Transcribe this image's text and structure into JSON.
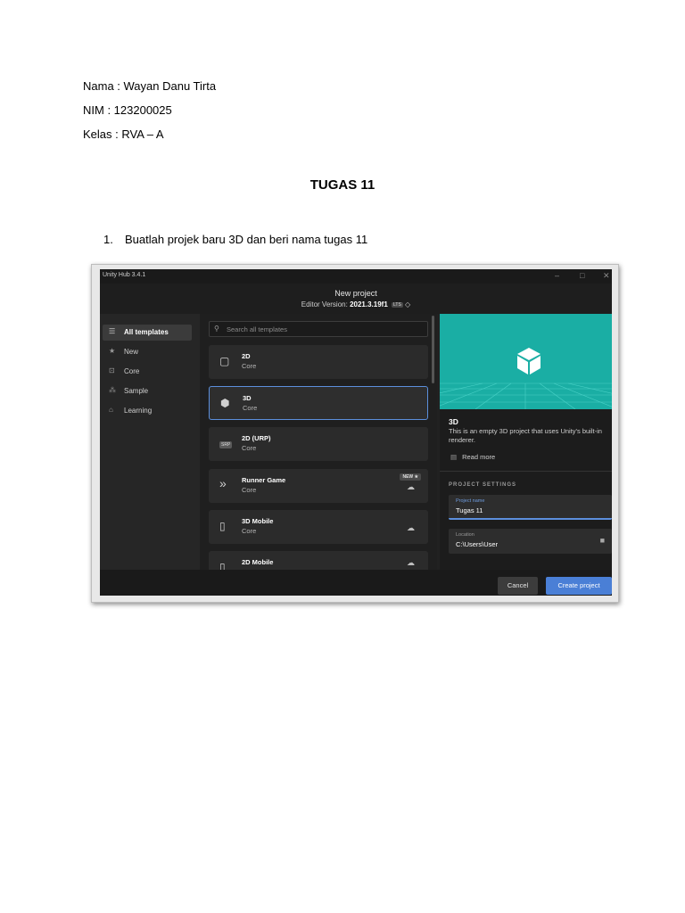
{
  "student": {
    "nama": "Nama : Wayan Danu Tirta",
    "nim": "NIM : 123200025",
    "kelas": "Kelas : RVA – A"
  },
  "doc_title": "TUGAS 11",
  "instruction": {
    "number": "1.",
    "text": "Buatlah projek baru 3D dan beri nama tugas 11"
  },
  "hub": {
    "app_title": "Unity Hub 3.4.1",
    "window_controls": [
      "–",
      "□",
      "✕"
    ],
    "header": {
      "title": "New project",
      "editor_label": "Editor Version:",
      "editor_version": "2021.3.19f1",
      "lts": "LTS",
      "chevron": "◇"
    },
    "sidebar": [
      {
        "label": "All templates",
        "icon": "list-icon",
        "glyph": "☰",
        "active": true
      },
      {
        "label": "New",
        "icon": "star-icon",
        "glyph": "★",
        "active": false
      },
      {
        "label": "Core",
        "icon": "core-icon",
        "glyph": "⊡",
        "active": false
      },
      {
        "label": "Sample",
        "icon": "sample-icon",
        "glyph": "⁂",
        "active": false
      },
      {
        "label": "Learning",
        "icon": "learning-icon",
        "glyph": "⌂",
        "active": false
      }
    ],
    "search_placeholder": "Search all templates",
    "templates": [
      {
        "name": "2D",
        "category": "Core",
        "icon": "square-icon",
        "glyph": "▢",
        "selected": false,
        "badge": "",
        "cloud": false
      },
      {
        "name": "3D",
        "category": "Core",
        "icon": "cube-icon",
        "glyph": "⬢",
        "selected": true,
        "badge": "",
        "cloud": false
      },
      {
        "name": "2D (URP)",
        "category": "Core",
        "icon": "srp-icon",
        "glyph": "SRP",
        "selected": false,
        "badge": "",
        "cloud": false
      },
      {
        "name": "Runner Game",
        "category": "Core",
        "icon": "chevrons-icon",
        "glyph": "»",
        "selected": false,
        "badge": "NEW ★",
        "cloud": true
      },
      {
        "name": "3D Mobile",
        "category": "Core",
        "icon": "phone-icon",
        "glyph": "▯",
        "selected": false,
        "badge": "",
        "cloud": true
      },
      {
        "name": "2D Mobile",
        "category": "Core",
        "icon": "phone-icon",
        "glyph": "▯",
        "selected": false,
        "badge": "",
        "cloud": true
      }
    ],
    "details": {
      "name": "3D",
      "description": "This is an empty 3D project that uses Unity's built-in renderer.",
      "read_more": "Read more",
      "section": "PROJECT SETTINGS",
      "project_name_label": "Project name",
      "project_name": "Tugas 11",
      "location_label": "Location",
      "location": "C:\\Users\\User"
    },
    "buttons": {
      "cancel": "Cancel",
      "create": "Create project"
    },
    "colors": {
      "accent": "#4a7fd6",
      "preview": "#1aaea4",
      "background": "#212121"
    }
  }
}
